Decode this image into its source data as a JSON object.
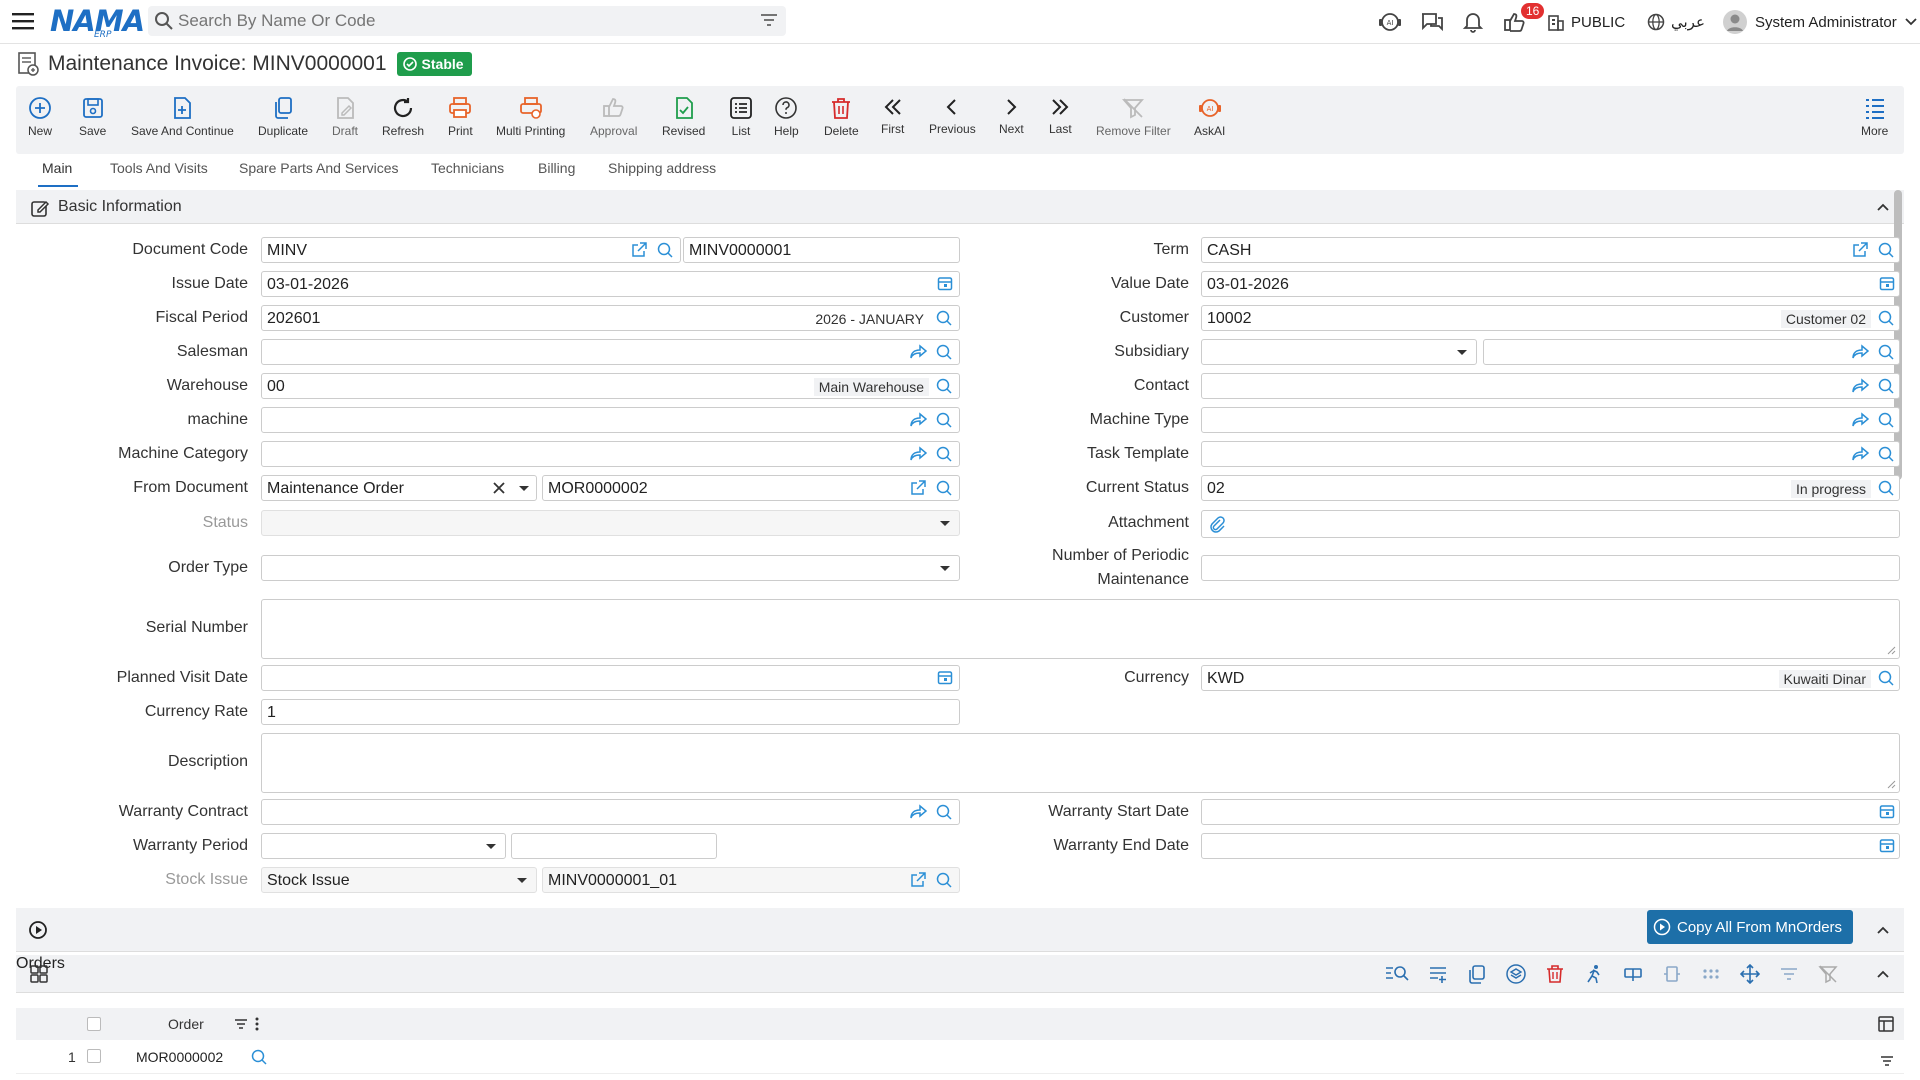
{
  "header": {
    "logo": "NAMA",
    "logo_sub": "ERP",
    "search_placeholder": "Search By Name Or Code",
    "notification_count": "16",
    "branch": "PUBLIC",
    "language": "عربي",
    "user": "System Administrator"
  },
  "page": {
    "title": "Maintenance Invoice: MINV0000001",
    "status_badge": "Stable"
  },
  "toolbar": {
    "new": "New",
    "save": "Save",
    "save_continue": "Save And Continue",
    "duplicate": "Duplicate",
    "draft": "Draft",
    "refresh": "Refresh",
    "print": "Print",
    "multi_printing": "Multi Printing",
    "approval": "Approval",
    "revised": "Revised",
    "list": "List",
    "help": "Help",
    "delete": "Delete",
    "first": "First",
    "previous": "Previous",
    "next": "Next",
    "last": "Last",
    "remove_filter": "Remove Filter",
    "askai": "AskAI",
    "more": "More"
  },
  "tabs": [
    "Main",
    "Tools And Visits",
    "Spare Parts And Services",
    "Technicians",
    "Billing",
    "Shipping address"
  ],
  "basic": {
    "title": "Basic Information",
    "labels": {
      "document_code": "Document Code",
      "issue_date": "Issue Date",
      "fiscal_period": "Fiscal Period",
      "salesman": "Salesman",
      "warehouse": "Warehouse",
      "machine": "machine",
      "machine_category": "Machine Category",
      "from_document": "From Document",
      "status": "Status",
      "order_type": "Order Type",
      "serial_number": "Serial Number",
      "planned_visit_date": "Planned Visit Date",
      "currency_rate": "Currency Rate",
      "description": "Description",
      "warranty_contract": "Warranty Contract",
      "warranty_period": "Warranty Period",
      "stock_issue": "Stock Issue",
      "term": "Term",
      "value_date": "Value Date",
      "customer": "Customer",
      "subsidiary": "Subsidiary",
      "contact": "Contact",
      "machine_type": "Machine Type",
      "task_template": "Task Template",
      "current_status": "Current Status",
      "attachment": "Attachment",
      "periodic_1": "Number of Periodic",
      "periodic_2": "Maintenance",
      "currency": "Currency",
      "warranty_start": "Warranty Start Date",
      "warranty_end": "Warranty End Date"
    },
    "values": {
      "document_code": "MINV",
      "document_number": "MINV0000001",
      "issue_date": "03-01-2026",
      "fiscal_period": "202601",
      "fiscal_period_name": "2026 - JANUARY",
      "warehouse": "00",
      "warehouse_name": "Main Warehouse",
      "from_document": "Maintenance Order",
      "from_document_no": "MOR0000002",
      "currency_rate": "1",
      "stock_issue": "Stock Issue",
      "stock_issue_no": "MINV0000001_01",
      "term": "CASH",
      "value_date": "03-01-2026",
      "customer": "10002",
      "customer_name": "Customer 02",
      "current_status": "02",
      "current_status_name": "In progress",
      "currency": "KWD",
      "currency_name": "Kuwaiti Dinar"
    }
  },
  "copy_button": "Copy All From MnOrders",
  "orders": {
    "title": "Orders",
    "column_order": "Order",
    "rows": [
      {
        "num": "1",
        "order": "MOR0000002"
      }
    ]
  }
}
